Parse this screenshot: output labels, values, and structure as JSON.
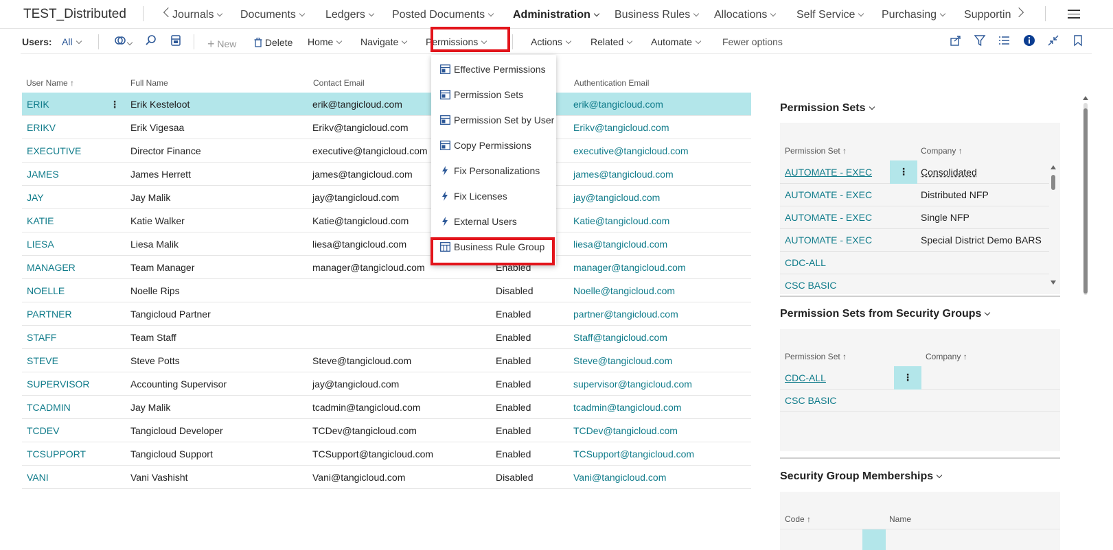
{
  "topnav": {
    "company": "TEST_Distributed",
    "items": [
      "Journals",
      "Documents",
      "Ledgers",
      "Posted Documents",
      "Administration",
      "Business Rules",
      "Allocations",
      "Self Service",
      "Purchasing",
      "Supporting"
    ],
    "active": "Administration"
  },
  "actionbar": {
    "page_label": "Users:",
    "filter": "All",
    "new": "New",
    "delete": "Delete",
    "home": "Home",
    "navigate": "Navigate",
    "permissions": "Permissions",
    "actions": "Actions",
    "related": "Related",
    "automate": "Automate",
    "fewer": "Fewer options"
  },
  "list": {
    "columns": {
      "user_name": "User Name ↑",
      "full_name": "Full Name",
      "contact_email": "Contact Email",
      "auth_email": "Authentication Email"
    },
    "rows": [
      {
        "user": "ERIK",
        "full": "Erik Kesteloot",
        "cemail": "erik@tangicloud.com",
        "state": "",
        "aemail": "erik@tangicloud.com"
      },
      {
        "user": "ERIKV",
        "full": "Erik Vigesaa",
        "cemail": "Erikv@tangicloud.com",
        "state": "",
        "aemail": "Erikv@tangicloud.com"
      },
      {
        "user": "EXECUTIVE",
        "full": "Director Finance",
        "cemail": "executive@tangicloud.com",
        "state": "",
        "aemail": "executive@tangicloud.com"
      },
      {
        "user": "JAMES",
        "full": "James Herrett",
        "cemail": "james@tangicloud.com",
        "state": "",
        "aemail": "james@tangicloud.com"
      },
      {
        "user": "JAY",
        "full": "Jay Malik",
        "cemail": "jay@tangicloud.com",
        "state": "",
        "aemail": "jay@tangicloud.com"
      },
      {
        "user": "KATIE",
        "full": "Katie Walker",
        "cemail": "Katie@tangicloud.com",
        "state": "",
        "aemail": "Katie@tangicloud.com"
      },
      {
        "user": "LIESA",
        "full": "Liesa Malik",
        "cemail": "liesa@tangicloud.com",
        "state": "",
        "aemail": "liesa@tangicloud.com"
      },
      {
        "user": "MANAGER",
        "full": "Team Manager",
        "cemail": "manager@tangicloud.com",
        "state": "Enabled",
        "aemail": "manager@tangicloud.com"
      },
      {
        "user": "NOELLE",
        "full": "Noelle Rips",
        "cemail": "",
        "state": "Disabled",
        "aemail": "Noelle@tangicloud.com"
      },
      {
        "user": "PARTNER",
        "full": "Tangicloud Partner",
        "cemail": "",
        "state": "Enabled",
        "aemail": "partner@tangicloud.com"
      },
      {
        "user": "STAFF",
        "full": "Team Staff",
        "cemail": "",
        "state": "Enabled",
        "aemail": "Staff@tangicloud.com"
      },
      {
        "user": "STEVE",
        "full": "Steve Potts",
        "cemail": "Steve@tangicloud.com",
        "state": "Enabled",
        "aemail": "Steve@tangicloud.com"
      },
      {
        "user": "SUPERVISOR",
        "full": "Accounting Supervisor",
        "cemail": "jay@tangicloud.com",
        "state": "Enabled",
        "aemail": "supervisor@tangicloud.com"
      },
      {
        "user": "TCADMIN",
        "full": "Jay Malik",
        "cemail": "tcadmin@tangicloud.com",
        "state": "Enabled",
        "aemail": "tcadmin@tangicloud.com"
      },
      {
        "user": "TCDEV",
        "full": "Tangicloud Developer",
        "cemail": "TCDev@tangicloud.com",
        "state": "Enabled",
        "aemail": "TCDev@tangicloud.com"
      },
      {
        "user": "TCSUPPORT",
        "full": "Tangicloud Support",
        "cemail": "TCSupport@tangicloud.com",
        "state": "Enabled",
        "aemail": "TCSupport@tangicloud.com"
      },
      {
        "user": "VANI",
        "full": "Vani Vashisht",
        "cemail": "Vani@tangicloud.com",
        "state": "Disabled",
        "aemail": "Vani@tangicloud.com"
      }
    ]
  },
  "menu": {
    "items": [
      {
        "label": "Effective Permissions",
        "icon": "grid-icon"
      },
      {
        "label": "Permission Sets",
        "icon": "grid-icon"
      },
      {
        "label": "Permission Set by User",
        "icon": "grid-icon"
      },
      {
        "label": "Copy Permissions",
        "icon": "grid-icon"
      },
      {
        "label": "Fix Personalizations",
        "icon": "bolt-icon"
      },
      {
        "label": "Fix Licenses",
        "icon": "bolt-icon"
      },
      {
        "label": "External Users",
        "icon": "bolt-icon"
      },
      {
        "label": "Business Rule Group",
        "icon": "table-icon"
      }
    ]
  },
  "factbox": {
    "permission_sets": {
      "title": "Permission Sets",
      "col_set": "Permission Set ↑",
      "col_company": "Company ↑",
      "rows": [
        {
          "set": "AUTOMATE - EXEC",
          "company": "Consolidated"
        },
        {
          "set": "AUTOMATE - EXEC",
          "company": "Distributed NFP"
        },
        {
          "set": "AUTOMATE - EXEC",
          "company": "Single NFP"
        },
        {
          "set": "AUTOMATE - EXEC",
          "company": "Special District Demo BARS"
        },
        {
          "set": "CDC-ALL",
          "company": ""
        },
        {
          "set": "CSC BASIC",
          "company": ""
        }
      ]
    },
    "security_group_sets": {
      "title": "Permission Sets from Security Groups",
      "col_set": "Permission Set ↑",
      "col_company": "Company ↑",
      "rows": [
        {
          "set": "CDC-ALL",
          "company": ""
        },
        {
          "set": "CSC BASIC",
          "company": ""
        }
      ]
    },
    "memberships": {
      "title": "Security Group Memberships",
      "col_code": "Code ↑",
      "col_name": "Name"
    }
  },
  "colors": {
    "accent": "#0f7b8a",
    "selected_row": "#b3e6ea",
    "highlight_box": "#e3141b"
  }
}
